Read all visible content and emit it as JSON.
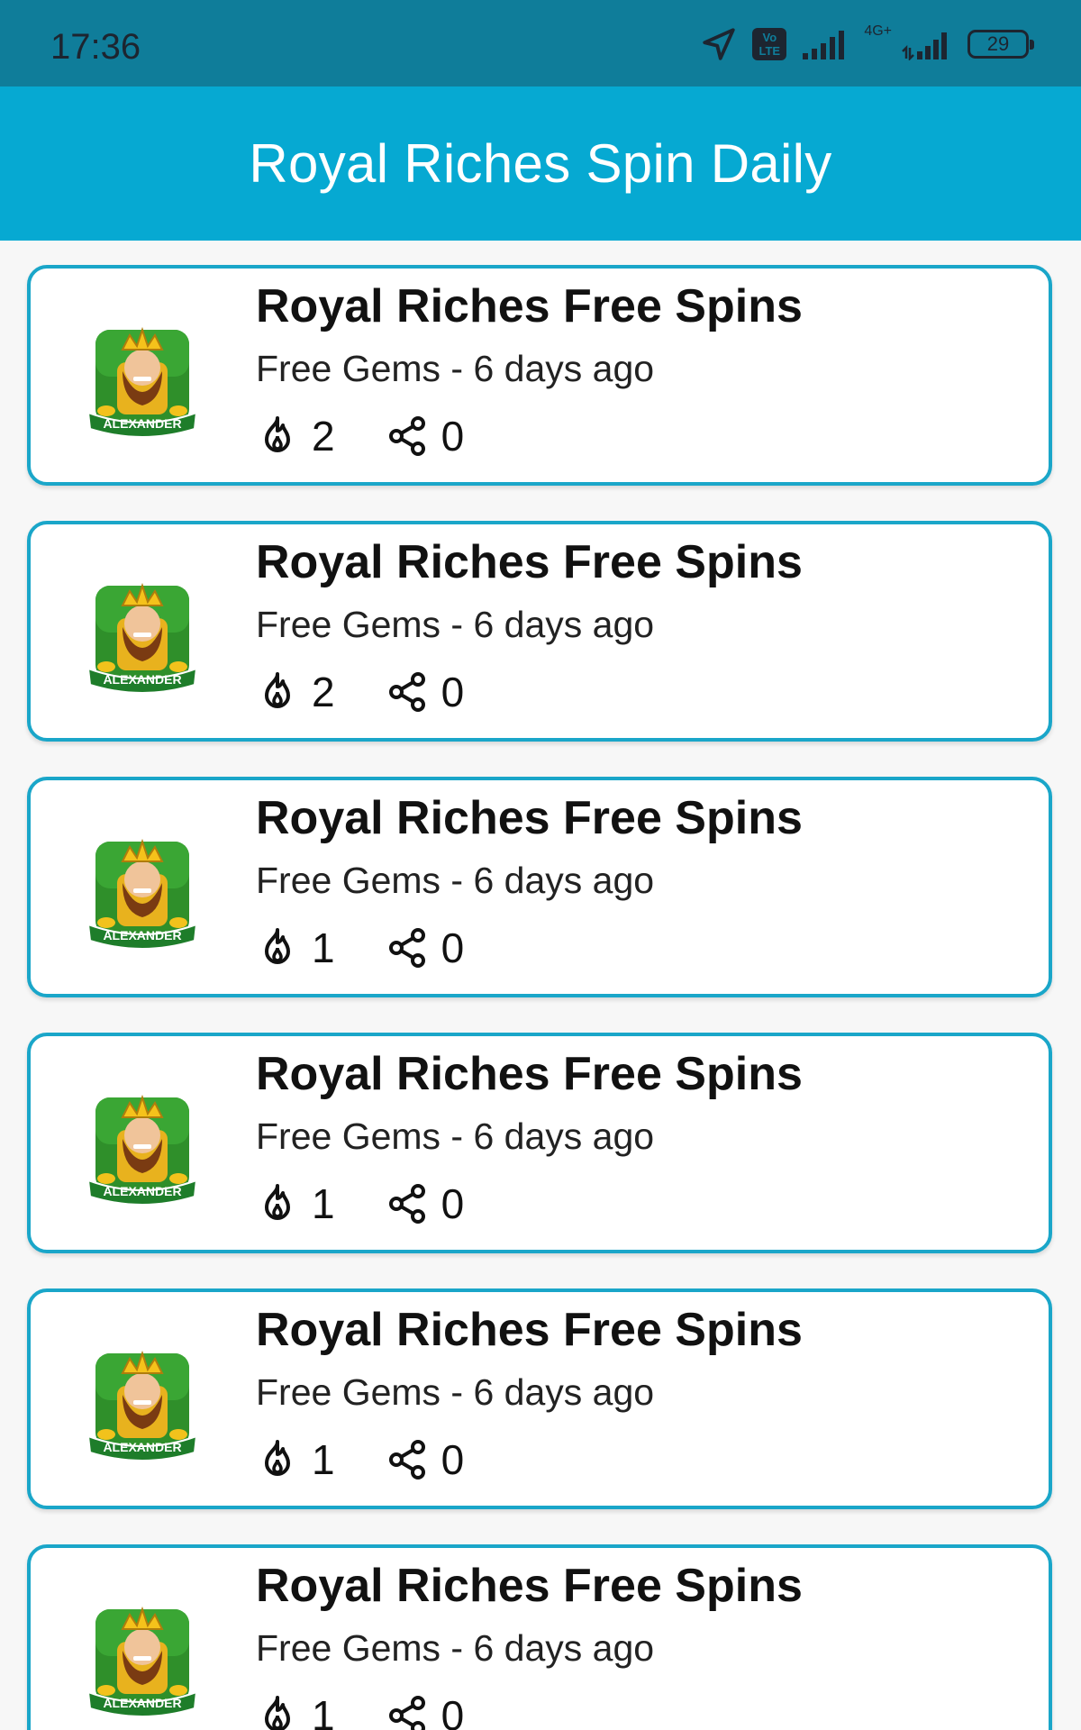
{
  "status_bar": {
    "time": "17:36",
    "volte_label": "Vo LTE",
    "network_label": "4G+",
    "battery": "29"
  },
  "app_bar": {
    "title": "Royal Riches Spin Daily"
  },
  "colors": {
    "status_bar": "#0f7d9a",
    "app_bar": "#06a9d2",
    "card_border": "#1aa6c9"
  },
  "items": [
    {
      "title": "Royal Riches Free Spins",
      "subtitle": "Free Gems - 6 days ago",
      "likes": "2",
      "shares": "0",
      "thumb_text": "ALEXANDER"
    },
    {
      "title": "Royal Riches Free Spins",
      "subtitle": "Free Gems - 6 days ago",
      "likes": "2",
      "shares": "0",
      "thumb_text": "ALEXANDER"
    },
    {
      "title": "Royal Riches Free Spins",
      "subtitle": "Free Gems - 6 days ago",
      "likes": "1",
      "shares": "0",
      "thumb_text": "ALEXANDER"
    },
    {
      "title": "Royal Riches Free Spins",
      "subtitle": "Free Gems - 6 days ago",
      "likes": "1",
      "shares": "0",
      "thumb_text": "ALEXANDER"
    },
    {
      "title": "Royal Riches Free Spins",
      "subtitle": "Free Gems - 6 days ago",
      "likes": "1",
      "shares": "0",
      "thumb_text": "ALEXANDER"
    },
    {
      "title": "Royal Riches Free Spins",
      "subtitle": "Free Gems - 6 days ago",
      "likes": "1",
      "shares": "0",
      "thumb_text": "ALEXANDER"
    }
  ]
}
